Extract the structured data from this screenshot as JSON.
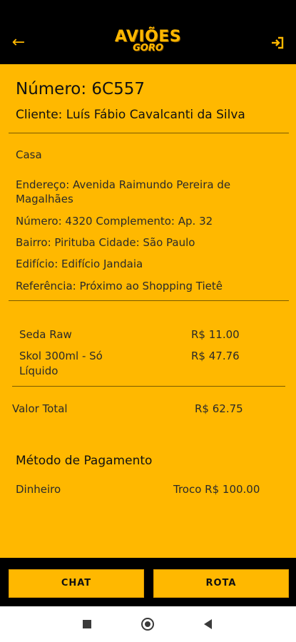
{
  "header": {
    "back_icon": "arrow-left-icon",
    "logout_icon": "logout-icon",
    "logo_top": "AVIÕES",
    "logo_bottom": "GORO"
  },
  "order": {
    "number": "Número: 6C557",
    "client": "Cliente: Luís Fábio Cavalcanti da Silva"
  },
  "address": {
    "type": "Casa",
    "street_line1": "Endereço: Avenida Raimundo Pereira de",
    "street_line2": "Magalhães",
    "number_complement": "Número: 4320 Complemento: Ap. 32",
    "district_city": "Bairro: Pirituba Cidade: São Paulo",
    "building": "Edifício: Edifício Jandaia",
    "reference": "Referência: Próximo ao Shopping Tietê"
  },
  "items": [
    {
      "name_line1": "Seda Raw",
      "name_line2": "",
      "price": "R$ 11.00"
    },
    {
      "name_line1": "Skol 300ml - Só",
      "name_line2": "Líquido",
      "price": "R$ 47.76"
    }
  ],
  "total": {
    "label": "Valor Total",
    "value": "R$ 62.75"
  },
  "payment": {
    "title": "Método de Pagamento",
    "method": "Dinheiro",
    "change": "Troco R$ 100.00"
  },
  "actions": {
    "chat_label": "CHAT",
    "route_label": "ROTA"
  },
  "colors": {
    "accent": "#FFB800",
    "bar": "#000000"
  }
}
